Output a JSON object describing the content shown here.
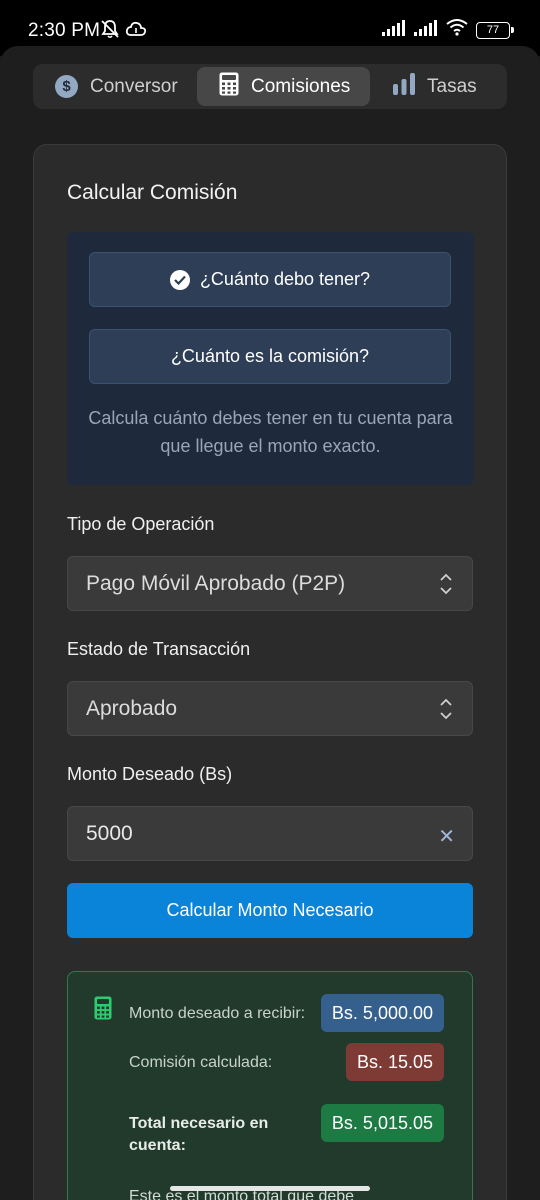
{
  "status_bar": {
    "time": "2:30 PM",
    "battery": "77"
  },
  "tabs": [
    {
      "label": "Conversor",
      "icon": "dollar-circle-icon"
    },
    {
      "label": "Comisiones",
      "icon": "calculator-icon"
    },
    {
      "label": "Tasas",
      "icon": "bar-chart-icon"
    }
  ],
  "card": {
    "title": "Calcular Comisión",
    "modes": [
      {
        "label": "¿Cuánto debo tener?",
        "selected": true
      },
      {
        "label": "¿Cuánto es la comisión?",
        "selected": false
      }
    ],
    "mode_description": "Calcula cuánto debes tener en tu cuenta para que llegue el monto exacto.",
    "operation_type": {
      "label": "Tipo de Operación",
      "value": "Pago Móvil Aprobado (P2P)"
    },
    "transaction_state": {
      "label": "Estado de Transacción",
      "value": "Aprobado"
    },
    "amount": {
      "label": "Monto Deseado (Bs)",
      "value": "5000"
    },
    "submit_label": "Calcular Monto Necesario"
  },
  "result": {
    "desired_label": "Monto deseado a recibir:",
    "desired_value": "Bs. 5,000.00",
    "commission_label": "Comisión calculada:",
    "commission_value": "Bs. 15.05",
    "total_label": "Total necesario en cuenta:",
    "total_value": "Bs. 5,015.05",
    "note": "Este es el monto total que debe"
  },
  "colors": {
    "accent": "#0a84d8",
    "pill_blue": "#35608d",
    "pill_red": "#7e3a34",
    "pill_green": "#1e7a43"
  }
}
